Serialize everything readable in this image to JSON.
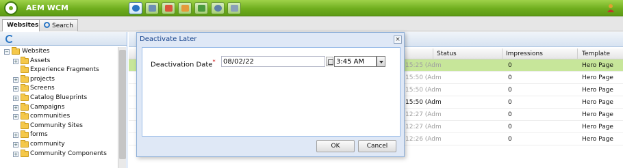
{
  "app": {
    "title": "AEM WCM"
  },
  "tabs": [
    {
      "label": "Websites",
      "active": true
    },
    {
      "label": "Search",
      "active": false
    }
  ],
  "toolbar_icons": [
    "websites-icon",
    "digital-assets-icon",
    "campaigns-icon",
    "inbox-icon",
    "users-icon",
    "tools-icon",
    "tags-icon"
  ],
  "tree": {
    "root": "Websites",
    "items": [
      {
        "label": "Assets",
        "expandable": true
      },
      {
        "label": "Experience Fragments",
        "expandable": false
      },
      {
        "label": "projects",
        "expandable": true
      },
      {
        "label": "Screens",
        "expandable": true
      },
      {
        "label": "Catalog Blueprints",
        "expandable": true
      },
      {
        "label": "Campaigns",
        "expandable": true
      },
      {
        "label": "communities",
        "expandable": true
      },
      {
        "label": "Community Sites",
        "expandable": false
      },
      {
        "label": "forms",
        "expandable": true
      },
      {
        "label": "community",
        "expandable": true
      },
      {
        "label": "Community Components",
        "expandable": true
      }
    ]
  },
  "grid": {
    "columns": [
      "Status",
      "Impressions",
      "Template"
    ],
    "rows": [
      {
        "modified": "15:25 (Adm",
        "impressions": "0",
        "template": "Hero Page",
        "selected": true,
        "dim": true
      },
      {
        "modified": "15:50 (Adm",
        "impressions": "0",
        "template": "Hero Page",
        "selected": false,
        "dim": true
      },
      {
        "modified": "15:50 (Adm",
        "impressions": "0",
        "template": "Hero Page",
        "selected": false,
        "dim": true
      },
      {
        "modified": "15:50 (Adm",
        "impressions": "0",
        "template": "Hero Page",
        "selected": false,
        "dim": false
      },
      {
        "modified": "12:27 (Adm",
        "impressions": "0",
        "template": "Hero Page",
        "selected": false,
        "dim": true
      },
      {
        "modified": "12:27 (Adm",
        "impressions": "0",
        "template": "Hero Page",
        "selected": false,
        "dim": true
      },
      {
        "modified": "12:26 (Adm",
        "impressions": "0",
        "template": "Hero Page",
        "selected": false,
        "dim": true
      }
    ]
  },
  "dialog": {
    "title": "Deactivate Later",
    "close_symbol": "×",
    "field_label": "Deactivation Date",
    "required_mark": "*",
    "date_value": "08/02/22",
    "time_value": "3:45 AM",
    "ok_label": "OK",
    "cancel_label": "Cancel"
  },
  "colors": {
    "topbar": "#6fae1e",
    "selected_row": "#c7e69a",
    "dialog_frame": "#dfe8f6",
    "dialog_title": "#15428b"
  }
}
